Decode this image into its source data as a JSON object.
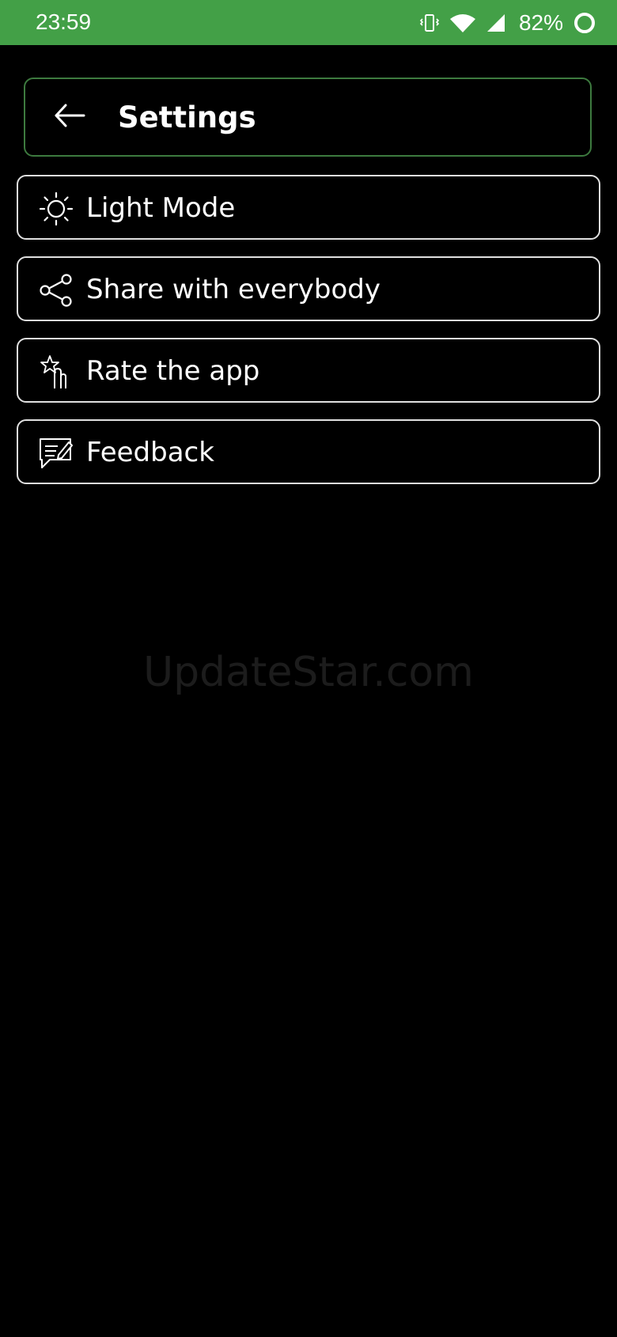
{
  "status_bar": {
    "time": "23:59",
    "battery_percent": "82%",
    "icons": [
      "vibrate-icon",
      "wifi-icon",
      "signal-icon",
      "battery-ring-icon"
    ],
    "background_color": "#43a047"
  },
  "header": {
    "title": "Settings",
    "back_icon": "arrow-left-icon",
    "border_color": "#3d7a3f"
  },
  "menu": {
    "items": [
      {
        "label": "Light Mode",
        "icon": "sun-icon"
      },
      {
        "label": "Share with everybody",
        "icon": "share-icon"
      },
      {
        "label": "Rate the app",
        "icon": "tap-star-icon"
      },
      {
        "label": "Feedback",
        "icon": "feedback-edit-icon"
      }
    ]
  },
  "watermark": {
    "text": "UpdateStar.com"
  },
  "colors": {
    "background": "#000000",
    "text": "#ffffff",
    "item_border": "#e0e0e0"
  }
}
